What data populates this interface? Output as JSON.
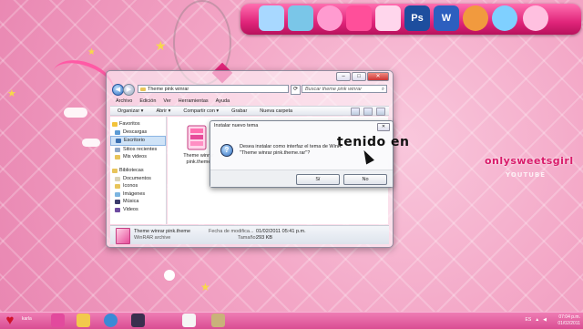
{
  "colors": {
    "accent": "#e0257a",
    "wallpaper": "#f3a6c6",
    "brand": "#d91a6a"
  },
  "dock": {
    "icons": [
      {
        "name": "cup-icon",
        "color": "#a8d8ff"
      },
      {
        "name": "bus-icon",
        "color": "#7ac6e8"
      },
      {
        "name": "headphones-icon",
        "color": "#ff9bd0"
      },
      {
        "name": "heart-icon",
        "color": "#ff4f9a"
      },
      {
        "name": "pencils-icon",
        "color": "#ffd6ec"
      },
      {
        "name": "photoshop-icon",
        "color": "#1d4e9e",
        "label": "Ps"
      },
      {
        "name": "word-icon",
        "color": "#2d5fbf",
        "label": "W"
      },
      {
        "name": "fox-icon",
        "color": "#f19a3e"
      },
      {
        "name": "chat-icon",
        "color": "#7fd0ff"
      },
      {
        "name": "music-icon",
        "color": "#ffc0e0"
      }
    ]
  },
  "explorer": {
    "address": "Theme pink winrar",
    "search_placeholder": "Buscar theme pink winrar",
    "menu": [
      "Archivo",
      "Edición",
      "Ver",
      "Herramientas",
      "Ayuda"
    ],
    "toolbar": [
      "Organizar ▾",
      "Abrir ▾",
      "Compartir con ▾",
      "Grabar",
      "Nueva carpeta"
    ],
    "nav": {
      "favorites_title": "Favoritos",
      "favorites": [
        "Descargas",
        "Escritorio",
        "Sitios recientes",
        "Mis videos"
      ],
      "libraries_title": "Bibliotecas",
      "libraries": [
        "Documentos",
        "Iconos",
        "Imágenes",
        "Música",
        "Videos"
      ]
    },
    "file": {
      "name": "Theme winrar pink.theme"
    },
    "details": {
      "name": "Theme winrar pink.theme",
      "type": "WinRAR archive",
      "modified_label": "Fecha de modifica...",
      "modified_value": "01/02/2011 05:41 p.m.",
      "size_label": "Tamaño:",
      "size_value": "293 KB"
    }
  },
  "dialog": {
    "title": "Instalar nuevo tema",
    "message": "Desea instalar como interfaz el tema de WinR \"Theme winrar pink.theme.rar\"?",
    "yes": "Sí",
    "no": "No"
  },
  "overlay_text": "tenido en",
  "brand": {
    "main": "onlysweetsgirl",
    "sub": "YOUTUBE"
  },
  "taskbar": {
    "user": "karla",
    "apps": [
      {
        "name": "photoshop-taskbar-icon",
        "color": "#e24a9d"
      },
      {
        "name": "folder-taskbar-icon",
        "color": "#f2c94c"
      },
      {
        "name": "ie-taskbar-icon",
        "color": "#3a8ad6"
      },
      {
        "name": "photoshop-dark-taskbar-icon",
        "color": "#3a2f4e"
      },
      {
        "name": "notepad-taskbar-icon",
        "color": "#f5f5f5"
      },
      {
        "name": "winrar-taskbar-icon",
        "color": "#c9b27a"
      }
    ],
    "language": "ES",
    "time": "07:04 p.m.",
    "date": "01/02/2011"
  }
}
